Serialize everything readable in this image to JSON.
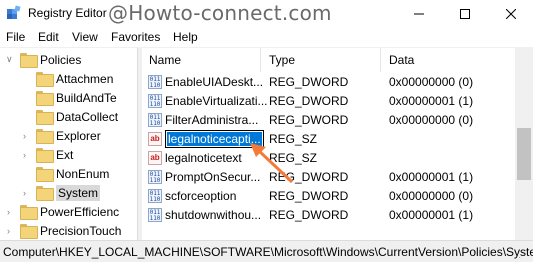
{
  "window": {
    "title": "Registry Editor",
    "watermark": "@Howto-connect.com"
  },
  "menu": [
    "File",
    "Edit",
    "View",
    "Favorites",
    "Help"
  ],
  "tree": {
    "items": [
      {
        "label": "Policies",
        "indent": 1,
        "expanded": true
      },
      {
        "label": "Attachmen",
        "indent": 2
      },
      {
        "label": "BuildAndTe",
        "indent": 2
      },
      {
        "label": "DataCollect",
        "indent": 2
      },
      {
        "label": "Explorer",
        "indent": 2
      },
      {
        "label": "Ext",
        "indent": 2
      },
      {
        "label": "NonEnum",
        "indent": 2
      },
      {
        "label": "System",
        "indent": 2,
        "selected": true
      },
      {
        "label": "PowerEfficienc",
        "indent": 1
      },
      {
        "label": "PrecisionTouch",
        "indent": 1
      }
    ]
  },
  "list": {
    "columns": {
      "name": "Name",
      "type": "Type",
      "data": "Data"
    },
    "rows": [
      {
        "icon": "dword",
        "name": "EnableUIADeskt...",
        "type": "REG_DWORD",
        "data": "0x00000000 (0)"
      },
      {
        "icon": "dword",
        "name": "EnableVirtualizati...",
        "type": "REG_DWORD",
        "data": "0x00000001 (1)"
      },
      {
        "icon": "dword",
        "name": "FilterAdministra...",
        "type": "REG_DWORD",
        "data": "0x00000000 (0)"
      },
      {
        "icon": "string",
        "name": "legalnoticecapti...",
        "type": "REG_SZ",
        "data": "",
        "editing": true
      },
      {
        "icon": "string",
        "name": "legalnoticetext",
        "type": "REG_SZ",
        "data": ""
      },
      {
        "icon": "dword",
        "name": "PromptOnSecur...",
        "type": "REG_DWORD",
        "data": "0x00000001 (1)"
      },
      {
        "icon": "dword",
        "name": "scforceoption",
        "type": "REG_DWORD",
        "data": "0x00000000 (0)"
      },
      {
        "icon": "dword",
        "name": "shutdownwithou...",
        "type": "REG_DWORD",
        "data": "0x00000001 (1)"
      }
    ]
  },
  "statusbar": {
    "path": "Computer\\HKEY_LOCAL_MACHINE\\SOFTWARE\\Microsoft\\Windows\\CurrentVersion\\Policies\\System"
  },
  "colors": {
    "selection": "#0078d7",
    "annotation_arrow": "#f47a3a"
  }
}
